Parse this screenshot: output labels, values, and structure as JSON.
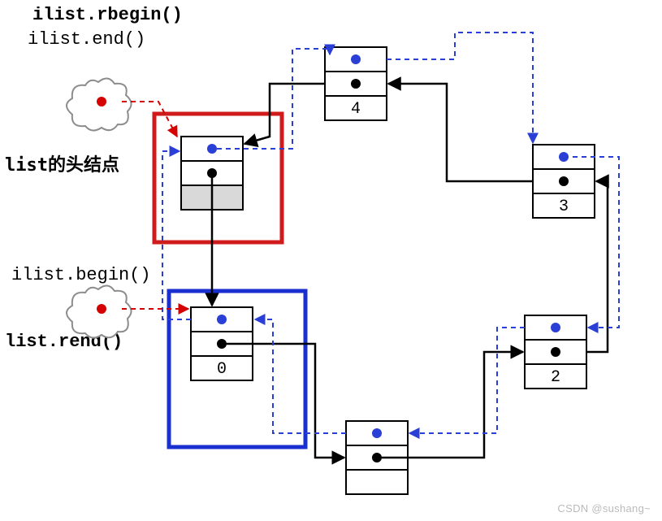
{
  "labels": {
    "rbegin": "ilist.rbegin()",
    "end": "ilist.end()",
    "begin": "ilist.begin()",
    "rend": "list.rend()",
    "headNode": "list的头结点"
  },
  "nodes": {
    "head": {
      "value": ""
    },
    "n0": {
      "value": "0"
    },
    "n1": {
      "value": ""
    },
    "n2": {
      "value": "2"
    },
    "n3": {
      "value": "3"
    },
    "n4": {
      "value": "4"
    }
  },
  "chart_data": {
    "type": "diagram",
    "structure": "circular doubly linked list (std::list) with sentinel head node",
    "sentinel": "head",
    "order_next": [
      "head",
      "n0",
      "n1",
      "n2",
      "n3",
      "n4",
      "head"
    ],
    "order_prev": [
      "head",
      "n4",
      "n3",
      "n2",
      "n1",
      "n0",
      "head"
    ],
    "iterator_positions": {
      "ilist.begin()": {
        "points_to": "n0",
        "highlight": "blue-box"
      },
      "ilist.end()": {
        "points_to": "head",
        "highlight": "red-box"
      },
      "ilist.rbegin()": {
        "points_to": "head(=end()) → reverse points at n4"
      },
      "ilist.rend()": {
        "points_to": "n0(=begin())"
      }
    },
    "node_display_values": {
      "head": null,
      "n0": 0,
      "n1": null,
      "n2": 2,
      "n3": 3,
      "n4": 4
    },
    "colors": {
      "next_pointer": "#000000",
      "prev_pointer": "#2a3fd6",
      "red_box": "#cf1b1b",
      "blue_box": "#1a2fd0",
      "iterator_dot": "#d40202",
      "cloud_outline": "#8c8c8c"
    }
  },
  "watermark": "CSDN @sushang~"
}
